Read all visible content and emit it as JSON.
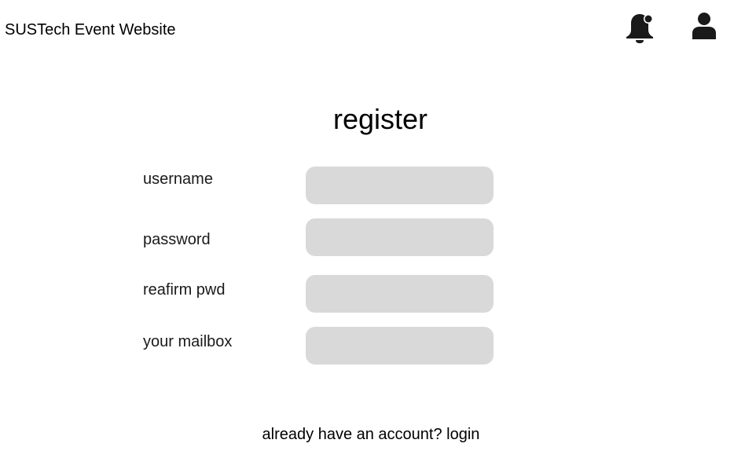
{
  "header": {
    "title": "SUSTech Event Website",
    "icons": [
      "bell-notification-icon",
      "user-profile-icon"
    ],
    "icon_color": "#1a1a1a"
  },
  "form": {
    "heading": "register",
    "fields": [
      {
        "label": "username",
        "value": ""
      },
      {
        "label": "password",
        "value": ""
      },
      {
        "label": "reafirm pwd",
        "value": ""
      },
      {
        "label": "your mailbox",
        "value": ""
      }
    ],
    "input_color": "#d9d9d9"
  },
  "footer": {
    "prompt": "already have an account?",
    "link_label": "login"
  }
}
